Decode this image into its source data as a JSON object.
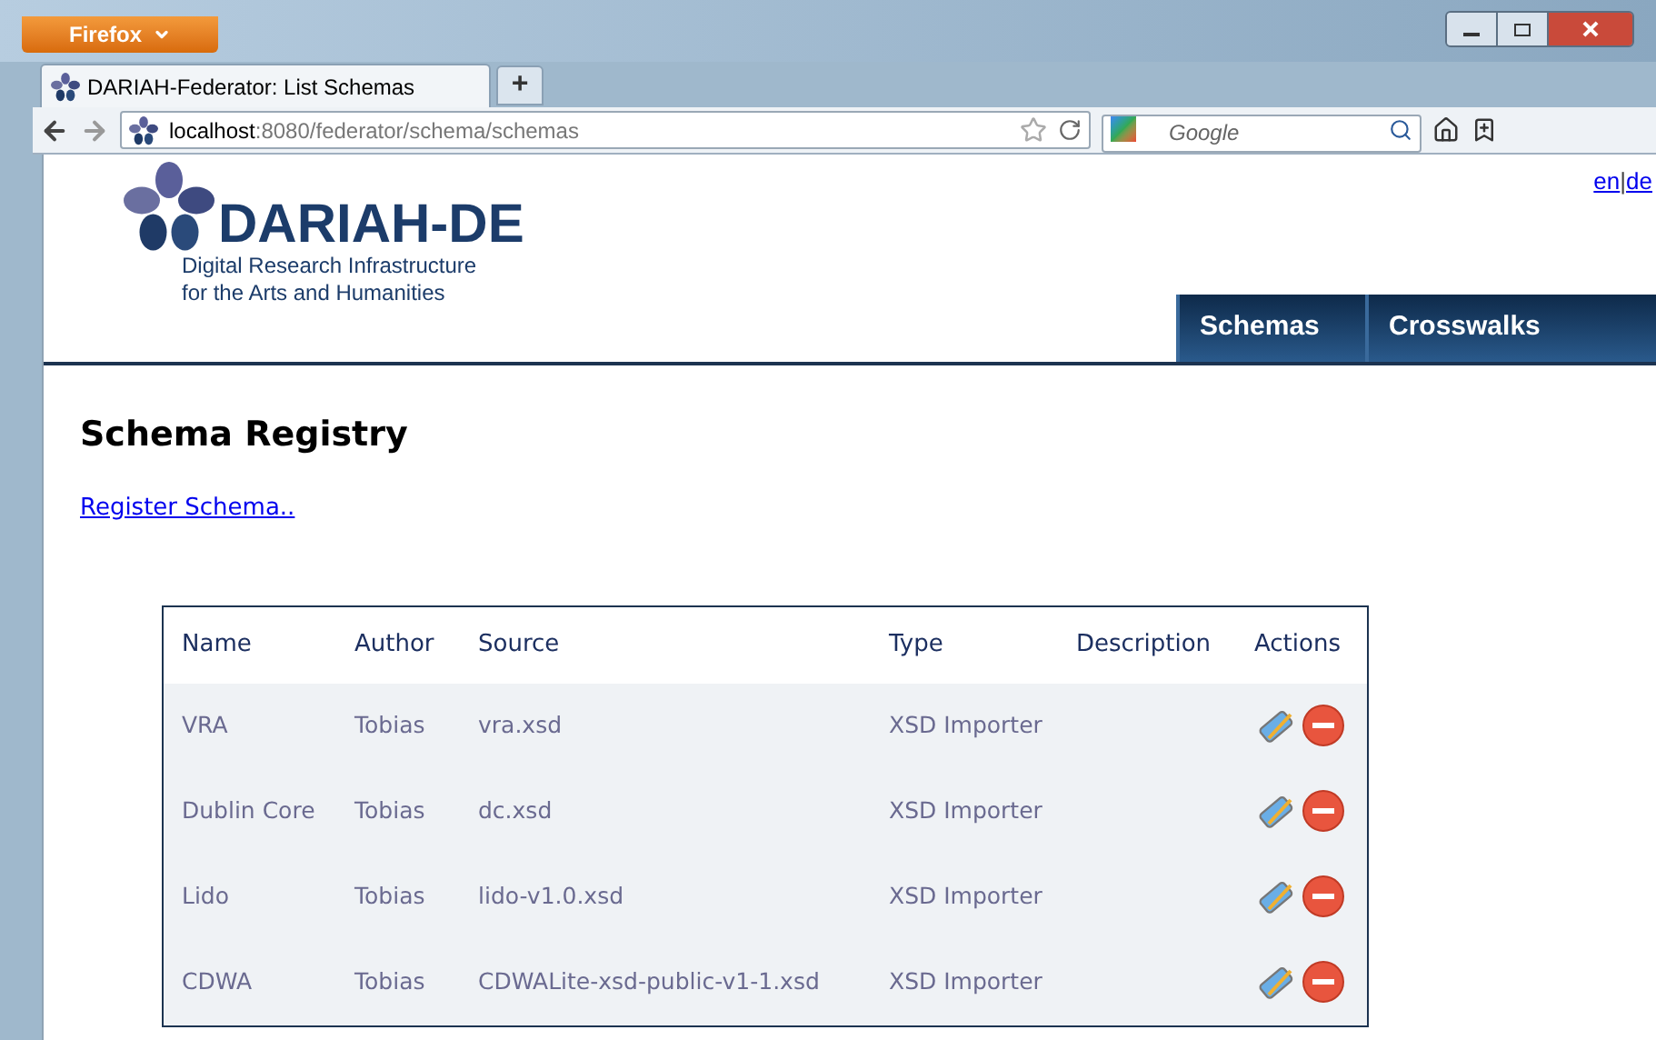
{
  "browser": {
    "menu_button": "Firefox",
    "tab_title": "DARIAH-Federator: List Schemas",
    "new_tab": "+",
    "url_host": "localhost",
    "url_rest": ":8080/federator/schema/schemas",
    "search_placeholder": "Google"
  },
  "header": {
    "languages": [
      "en",
      "de"
    ],
    "separator": "|",
    "logo_name": "DARIAH-DE",
    "logo_tagline": [
      "Digital Research Infrastructure",
      "for the Arts and Humanities"
    ],
    "nav": [
      "Schemas",
      "Crosswalks"
    ]
  },
  "heading": "Schema Registry",
  "register_link": "Register Schema..",
  "table": {
    "columns": [
      "Name",
      "Author",
      "Source",
      "Type",
      "Description",
      "Actions"
    ],
    "rows": [
      {
        "name": "VRA",
        "author": "Tobias",
        "source": "vra.xsd",
        "type": "XSD Importer"
      },
      {
        "name": "Dublin Core",
        "author": "Tobias",
        "source": "dc.xsd",
        "type": "XSD Importer"
      },
      {
        "name": "Lido",
        "author": "Tobias",
        "source": "lido-v1.0.xsd",
        "type": "XSD Importer"
      },
      {
        "name": "CDWA",
        "author": "Tobias",
        "source": "CDWALite-xsd-public-v1-1.xsd",
        "type": "XSD Importer"
      }
    ]
  }
}
